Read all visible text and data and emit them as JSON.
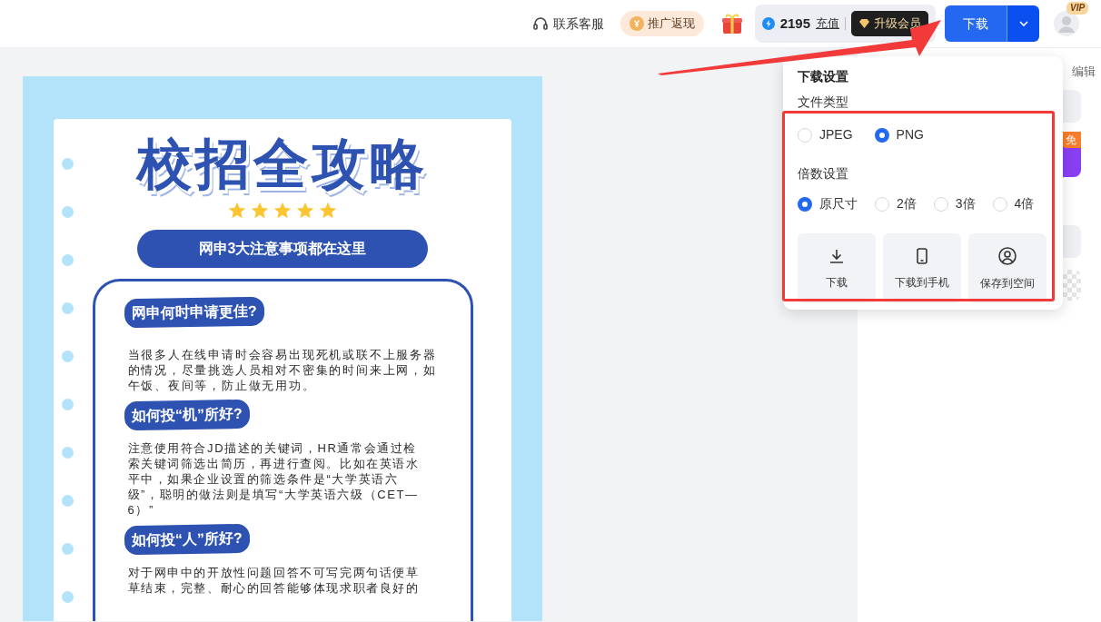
{
  "header": {
    "support": "联系客服",
    "promo": "推广返现",
    "points": "2195",
    "recharge": "充值",
    "upgrade": "升级会员",
    "download": "下载",
    "vip": "VIP"
  },
  "poster": {
    "title": "校招全攻略",
    "stars": 5,
    "subtitle": "网申3大注意事项都在这里",
    "sections": [
      {
        "heading": "网申何时申请更佳?",
        "body": "当很多人在线申请时会容易出现死机或联不上服务器的情况，尽量挑选人员相对不密集的时间来上网，如午饭、夜间等，防止做无用功。"
      },
      {
        "heading": "如何投“机”所好?",
        "body": "注意使用符合JD描述的关键词，HR通常会通过检索关键词筛选出简历，再进行查阅。比如在英语水平中，如果企业设置的筛选条件是“大学英语六级”，聪明的做法则是填写“大学英语六级（CET—6）”"
      },
      {
        "heading": "如何投“人”所好?",
        "body": "对于网申中的开放性问题回答不可写完两句话便草草结束，完整、耐心的回答能够体现求职者良好的"
      }
    ]
  },
  "side_panel": {
    "edit": "编辑",
    "badge": "免"
  },
  "download_menu": {
    "title": "下载设置",
    "file_type_label": "文件类型",
    "file_types": [
      {
        "label": "JPEG",
        "selected": false
      },
      {
        "label": "PNG",
        "selected": true
      }
    ],
    "scale_label": "倍数设置",
    "scales": [
      {
        "label": "原尺寸",
        "selected": true
      },
      {
        "label": "2倍",
        "selected": false
      },
      {
        "label": "3倍",
        "selected": false
      },
      {
        "label": "4倍",
        "selected": false
      }
    ],
    "actions": [
      {
        "kind": "download",
        "label": "下载"
      },
      {
        "kind": "phone",
        "label": "下载到手机"
      },
      {
        "kind": "space",
        "label": "保存到空间"
      }
    ]
  }
}
